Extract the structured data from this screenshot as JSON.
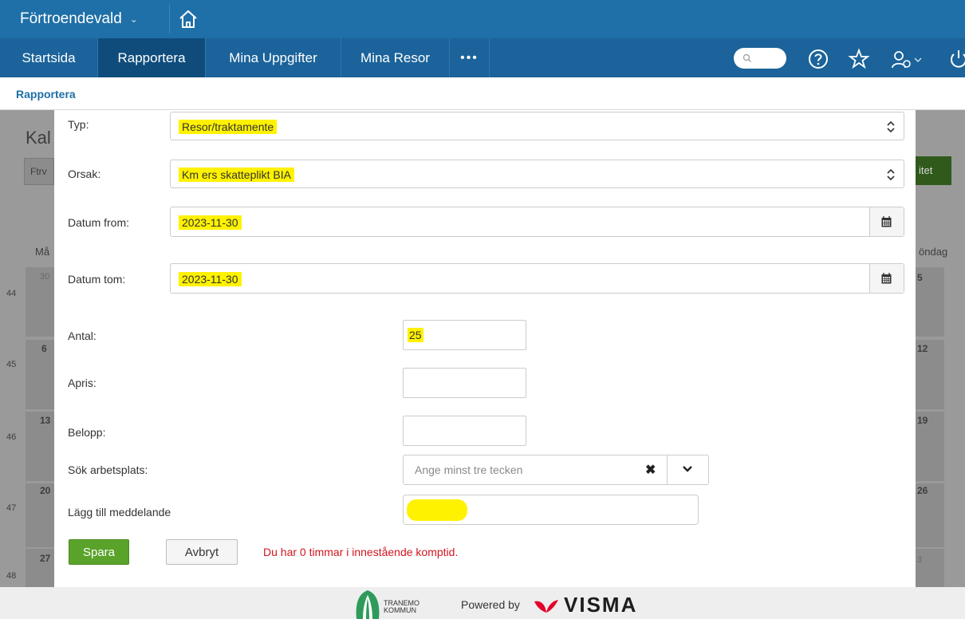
{
  "header": {
    "app_title": "Förtroendevald",
    "tabs": [
      {
        "label": "Startsida"
      },
      {
        "label": "Rapportera"
      },
      {
        "label": "Mina Uppgifter"
      },
      {
        "label": "Mina Resor"
      },
      {
        "label": "•••"
      }
    ],
    "icons": [
      "home-icon",
      "search-icon",
      "help-icon",
      "star-icon",
      "user-settings-icon",
      "power-icon"
    ]
  },
  "breadcrumb": "Rapportera",
  "background": {
    "title": "Kal",
    "filter": "Ftrv",
    "button": "itet",
    "weekday_left": "Må",
    "weekday_right": "öndag",
    "weeks": [
      "44",
      "45",
      "46",
      "47",
      "48"
    ],
    "left_days": [
      "30",
      "6",
      "13",
      "20",
      "27"
    ],
    "right_days": [
      "5",
      "12",
      "19",
      "26",
      "3"
    ]
  },
  "form": {
    "type": {
      "label": "Typ:",
      "value": "Resor/traktamente"
    },
    "reason": {
      "label": "Orsak:",
      "value": "Km ers skatteplikt BIA"
    },
    "date_from": {
      "label": "Datum from:",
      "value": "2023-11-30"
    },
    "date_to": {
      "label": "Datum tom:",
      "value": "2023-11-30"
    },
    "quantity": {
      "label": "Antal:",
      "value": "25"
    },
    "unit_price": {
      "label": "Apris:",
      "value": ""
    },
    "amount": {
      "label": "Belopp:",
      "value": ""
    },
    "workplace": {
      "label": "Sök arbetsplats:",
      "placeholder": "Ange minst tre tecken"
    },
    "message": {
      "label": "Lägg till meddelande",
      "value": ""
    },
    "save_label": "Spara",
    "cancel_label": "Avbryt",
    "warning": "Du har 0 timmar i innestående komptid."
  },
  "footer": {
    "municipality_line1": "TRANEMO",
    "municipality_line2": "KOMMUN",
    "powered_by": "Powered by",
    "brand": "VISMA"
  },
  "colors": {
    "header": "#1f6fa8",
    "active_tab": "#0f4c7c",
    "save_button": "#5aa32b",
    "highlight": "#fff200",
    "warning": "#d2161e"
  }
}
